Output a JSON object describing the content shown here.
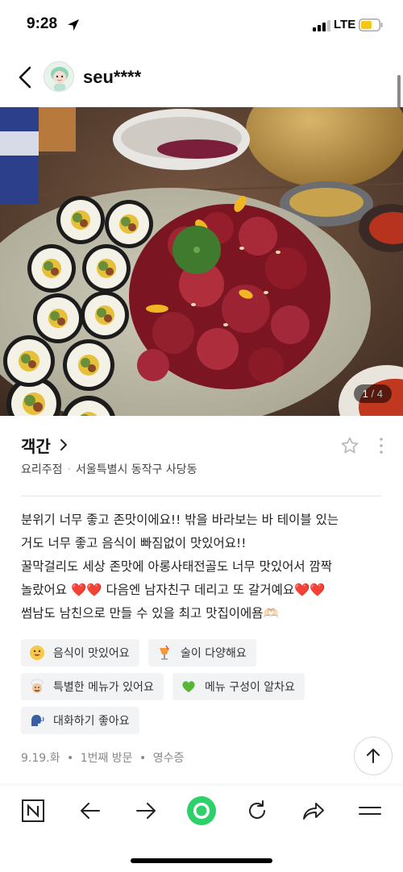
{
  "status_bar": {
    "time": "9:28",
    "network": "LTE",
    "icons": [
      "location-arrow-icon",
      "signal-icon",
      "battery-icon"
    ]
  },
  "header": {
    "username": "seu****",
    "icons": [
      "back-icon",
      "avatar"
    ]
  },
  "photo": {
    "current": "1",
    "separator": "/",
    "total": "4"
  },
  "place": {
    "name": "객간",
    "category": "요리주점",
    "address": "서울특별시 동작구 사당동"
  },
  "review": {
    "lines": [
      "분위기 너무 좋고 존맛이에요!! 밖을 바라보는 바 테이블 있는",
      "거도 너무 좋고 음식이 빠짐없이 맛있어요!!",
      "꿀막걸리도 세상 존맛에 아롱사태전골도 너무 맛있어서 깜짝",
      "놀랐어요 ❤️❤️ 다음엔 남자친구 데리고 또 갈거예요❤️❤️",
      "썸남도 남친으로 만들 수 있을 최고 맛집이에욤🫶🏻"
    ]
  },
  "tags": [
    {
      "label": "음식이 맛있어요",
      "icon": "smiley-icon"
    },
    {
      "label": "술이 다양해요",
      "icon": "cocktail-icon"
    },
    {
      "label": "특별한 메뉴가 있어요",
      "icon": "chef-icon"
    },
    {
      "label": "메뉴 구성이 알차요",
      "icon": "green-heart-icon"
    },
    {
      "label": "대화하기 좋아요",
      "icon": "speaking-head-icon"
    }
  ],
  "visit": {
    "date": "9.19.화",
    "count": "1번째 방문",
    "proof": "영수증",
    "separator": "•"
  },
  "bottom_bar": {
    "icons": [
      "naver-n-icon",
      "back-arrow-icon",
      "forward-arrow-icon",
      "home-green-icon",
      "refresh-icon",
      "share-icon",
      "menu-icon"
    ]
  },
  "colors": {
    "accent_green": "#2dd06b",
    "tag_bg": "#f2f3f5",
    "heart_red": "#c0192a"
  }
}
